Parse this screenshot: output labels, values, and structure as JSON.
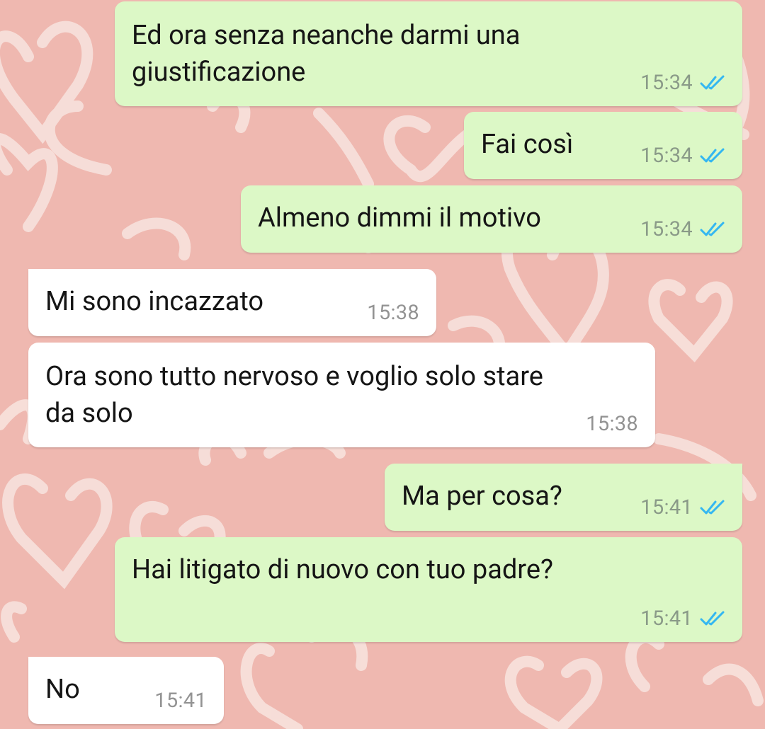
{
  "messages": [
    {
      "id": "m1",
      "direction": "outgoing",
      "text": "Ed ora senza neanche darmi una\ngiustificazione",
      "time": "15:34",
      "status_icon": "double-check-read-icon"
    },
    {
      "id": "m2",
      "direction": "outgoing",
      "text": "Fai così",
      "time": "15:34",
      "status_icon": "double-check-read-icon"
    },
    {
      "id": "m3",
      "direction": "outgoing",
      "text": "Almeno dimmi il motivo",
      "time": "15:34",
      "status_icon": "double-check-read-icon"
    },
    {
      "id": "m4",
      "direction": "incoming",
      "text": "Mi sono incazzato",
      "time": "15:38"
    },
    {
      "id": "m5",
      "direction": "incoming",
      "text": "Ora sono tutto nervoso e voglio solo stare\nda solo",
      "time": "15:38"
    },
    {
      "id": "m6",
      "direction": "outgoing",
      "text": "Ma per cosa?",
      "time": "15:41",
      "status_icon": "double-check-read-icon"
    },
    {
      "id": "m7",
      "direction": "outgoing",
      "text": "Hai litigato di nuovo con tuo padre?",
      "time": "15:41",
      "status_icon": "double-check-read-icon"
    },
    {
      "id": "m8",
      "direction": "incoming",
      "text": "No",
      "time": "15:41"
    }
  ],
  "colors": {
    "background": "#efb8b0",
    "outgoing_bubble": "#dcf8c6",
    "incoming_bubble": "#ffffff",
    "read_tick": "#34b7f1"
  }
}
